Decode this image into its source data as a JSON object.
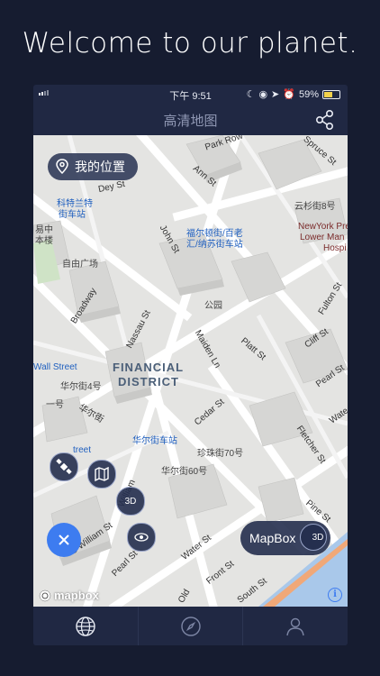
{
  "headline": "Welcome to our planet.",
  "status_bar": {
    "time": "下午 9:51",
    "battery": "59%"
  },
  "nav": {
    "title": "高清地图",
    "share_icon": "share-icon"
  },
  "location_button": {
    "label": "我的位置",
    "icon": "location-pin-icon"
  },
  "map": {
    "district": [
      "FINANCIAL",
      "DISTRICT"
    ],
    "streets": {
      "park_row": "Park Row",
      "spruce_st": "Spruce St",
      "ann_st": "Ann St",
      "dey_st": "Dey St",
      "john_st": "John St",
      "broadway": "Broadway",
      "nassau_st": "Nassau St",
      "maiden_ln": "Maiden Ln",
      "platt_st": "Platt St",
      "fulton_st": "Fulton St",
      "cliff_st": "Cliff St",
      "pearl_st_1": "Pearl St",
      "cedar_st": "Cedar St",
      "fletcher_st": "Fletcher St",
      "wall_street": "Wall Street",
      "water_st": "Water St",
      "william_st": "William",
      "s_william_st": "S William St",
      "pearl_st_2": "Pearl St",
      "front_st": "Front St",
      "south_st": "South St",
      "pine_st": "Pine St",
      "water_st_2": "Wate",
      "street_frag": "treet",
      "old_slip": "Old"
    },
    "places": {
      "cortlandt": "科特兰特",
      "cortlandt_station": "街车站",
      "fulton_station_1": "福尔顿街/百老",
      "fulton_station_2": "汇/纳苏街车站",
      "free_plaza": "自由广场",
      "spruce_8": "云杉街8号",
      "ny_pres": "NewYork Pres",
      "lower_man": "Lower Man",
      "hospi": "Hospi",
      "wall_st_4": "华尔街4号",
      "wall_st_cn": "华尔街",
      "wall_st_station": "华尔街车站",
      "wall_st_60": "华尔街60号",
      "pearl_70": "珍珠街70号",
      "park_1": "公园",
      "one": "一号",
      "center_1": "中心",
      "left_1": "易中",
      "left_2": "本楼"
    }
  },
  "map_controls": {
    "satellite_icon": "satellite-icon",
    "map_icon": "folded-map-icon",
    "view3d_label": "3D",
    "compass_icon": "tilt-view-icon",
    "close_icon": "close-icon"
  },
  "style_switch": {
    "label": "MapBox",
    "badge": "3D"
  },
  "attribution": {
    "logo": "mapbox",
    "info": "i"
  },
  "tabs": [
    {
      "name": "globe",
      "icon": "globe-icon"
    },
    {
      "name": "compass",
      "icon": "compass-icon"
    },
    {
      "name": "profile",
      "icon": "profile-icon"
    }
  ],
  "colors": {
    "accent": "#3d7cf0",
    "background": "#161c30",
    "panel": "#202843",
    "water": "#a9c8ea"
  }
}
